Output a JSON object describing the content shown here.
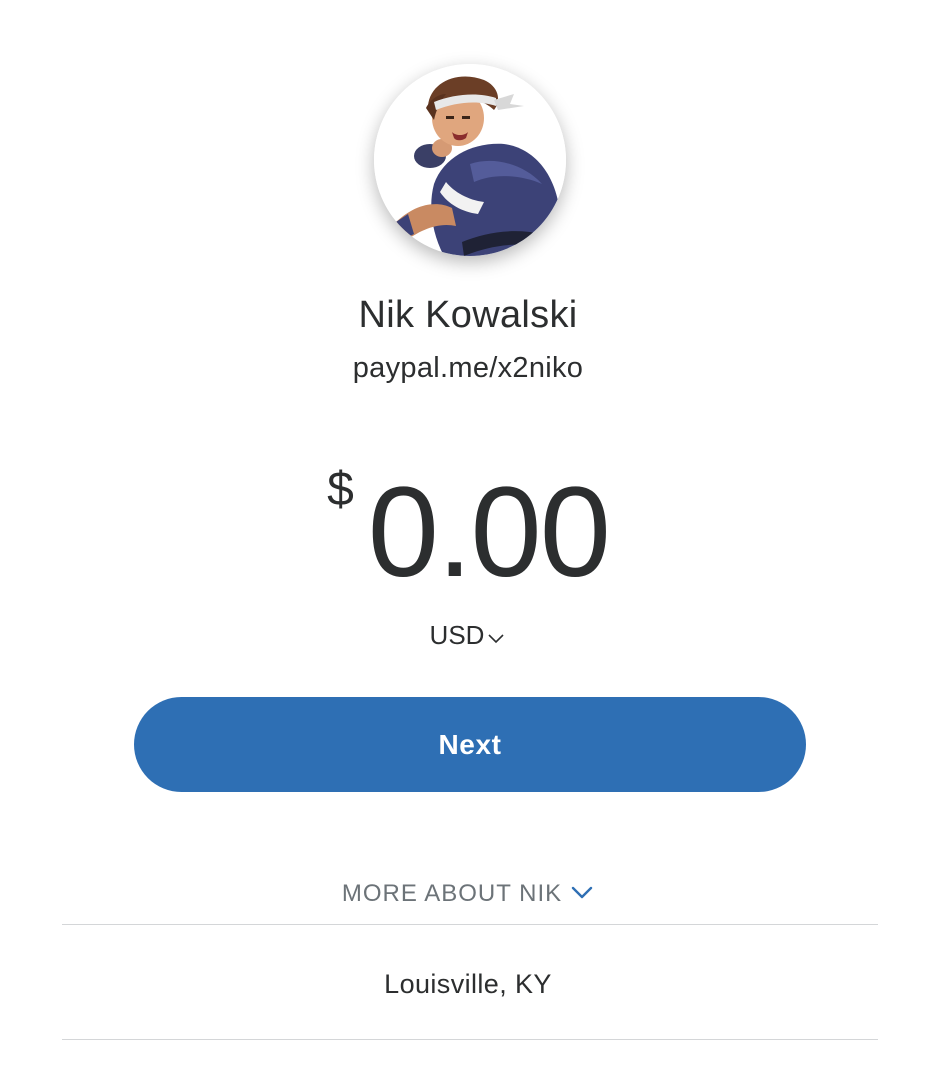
{
  "profile": {
    "name": "Nik Kowalski",
    "link": "paypal.me/x2niko",
    "avatar_icon": "avatar-fighter-character"
  },
  "payment": {
    "currency_symbol": "$",
    "amount": "0.00",
    "currency_code": "USD",
    "currency_dropdown_icon": "chevron-down-icon"
  },
  "actions": {
    "next_label": "Next"
  },
  "more_about": {
    "label": "MORE ABOUT NIK",
    "icon": "chevron-down-icon",
    "location": "Louisville, KY"
  },
  "colors": {
    "primary_button": "#2e6fb4",
    "text": "#2c2e2f",
    "muted_text": "#6c7378",
    "divider": "#d4d6d8",
    "accent_chevron": "#2e6fb4"
  }
}
